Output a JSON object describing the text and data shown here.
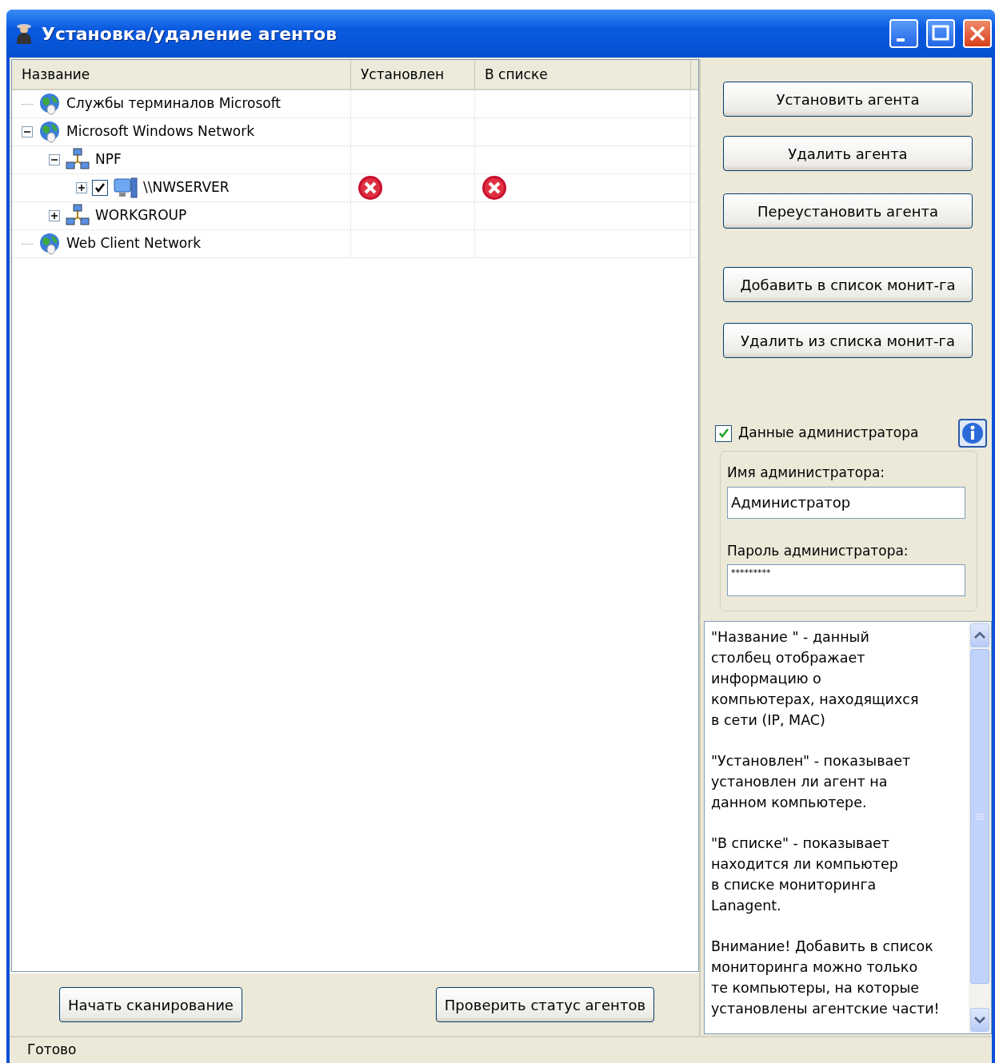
{
  "window": {
    "title": "Установка/удаление агентов"
  },
  "table": {
    "columns": [
      "Название",
      "Установлен",
      "В списке"
    ],
    "rows": [
      {
        "label": "Службы терминалов Microsoft",
        "kind": "globe"
      },
      {
        "label": "Microsoft Windows Network",
        "kind": "globe",
        "expanded": true,
        "children": [
          {
            "label": "NPF",
            "kind": "network",
            "expanded": true,
            "children": [
              {
                "label": "\\\\NWSERVER",
                "kind": "computer",
                "expanded": false,
                "checked": true,
                "installed": false,
                "in_list": false
              }
            ]
          },
          {
            "label": "WORKGROUP",
            "kind": "network",
            "expanded": false
          }
        ]
      },
      {
        "label": "Web Client Network",
        "kind": "globe"
      }
    ]
  },
  "actions": [
    "Установить агента",
    "Удалить агента",
    "Переустановить агента",
    "Добавить в список монит-га",
    "Удалить из списка монит-га"
  ],
  "admin": {
    "label": "Данные администратора",
    "checked": true,
    "name_label": "Имя администратора:",
    "name_value": "Администратор",
    "password_label": "Пароль администратора:",
    "password_value": "*********"
  },
  "help": [
    [
      "\"Название \" - данный",
      "столбец отображает",
      "информацию о",
      "компьютерах, находящихся",
      "в сети (IP, MAC)"
    ],
    [
      "\"Установлен\" - показывает",
      "установлен ли агент на",
      "данном компьютере."
    ],
    [
      "\"В списке\" - показывает",
      "находится ли компьютер",
      "в списке мониторинга",
      "Lanagent."
    ],
    [
      "Внимание! Добавить в список",
      "мониторинга можно только",
      "те компьютеры, на которые",
      "установлены агентские части!"
    ]
  ],
  "bottom_buttons": [
    "Начать сканирование",
    "Проверить статус агентов"
  ],
  "status_bar": "Готово"
}
